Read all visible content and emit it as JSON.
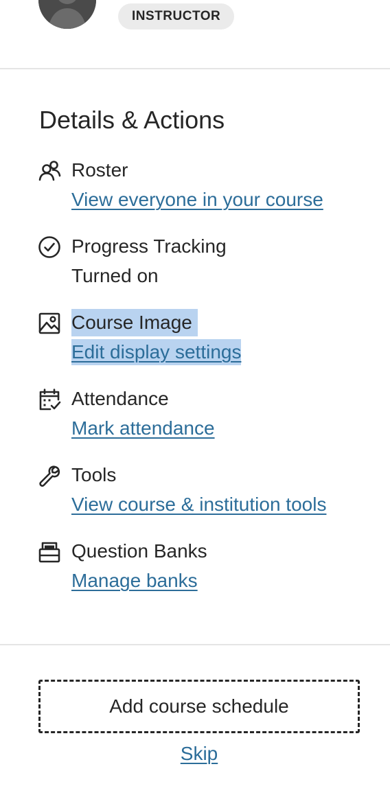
{
  "header": {
    "role_badge": "INSTRUCTOR"
  },
  "details": {
    "title": "Details & Actions",
    "items": [
      {
        "icon": "roster-icon",
        "title": "Roster",
        "subtitle": "View everyone in your course",
        "subtitle_is_link": true
      },
      {
        "icon": "check-circle-icon",
        "title": "Progress Tracking",
        "subtitle": "Turned on",
        "subtitle_is_link": false
      },
      {
        "icon": "image-icon",
        "title": "Course Image",
        "subtitle": "Edit display settings",
        "subtitle_is_link": true,
        "text_selected": true
      },
      {
        "icon": "calendar-check-icon",
        "title": "Attendance",
        "subtitle": "Mark attendance",
        "subtitle_is_link": true
      },
      {
        "icon": "wrench-icon",
        "title": "Tools",
        "subtitle": "View course & institution tools",
        "subtitle_is_link": true
      },
      {
        "icon": "question-bank-icon",
        "title": "Question Banks",
        "subtitle": "Manage banks",
        "subtitle_is_link": true
      }
    ]
  },
  "schedule": {
    "button_label": "Add course schedule",
    "skip_label": "Skip"
  },
  "colors": {
    "link": "#2c6d99",
    "text": "#262626",
    "selection": "#b9d3f0",
    "divider": "#e5e5e5",
    "badge_bg": "#ebebeb"
  }
}
